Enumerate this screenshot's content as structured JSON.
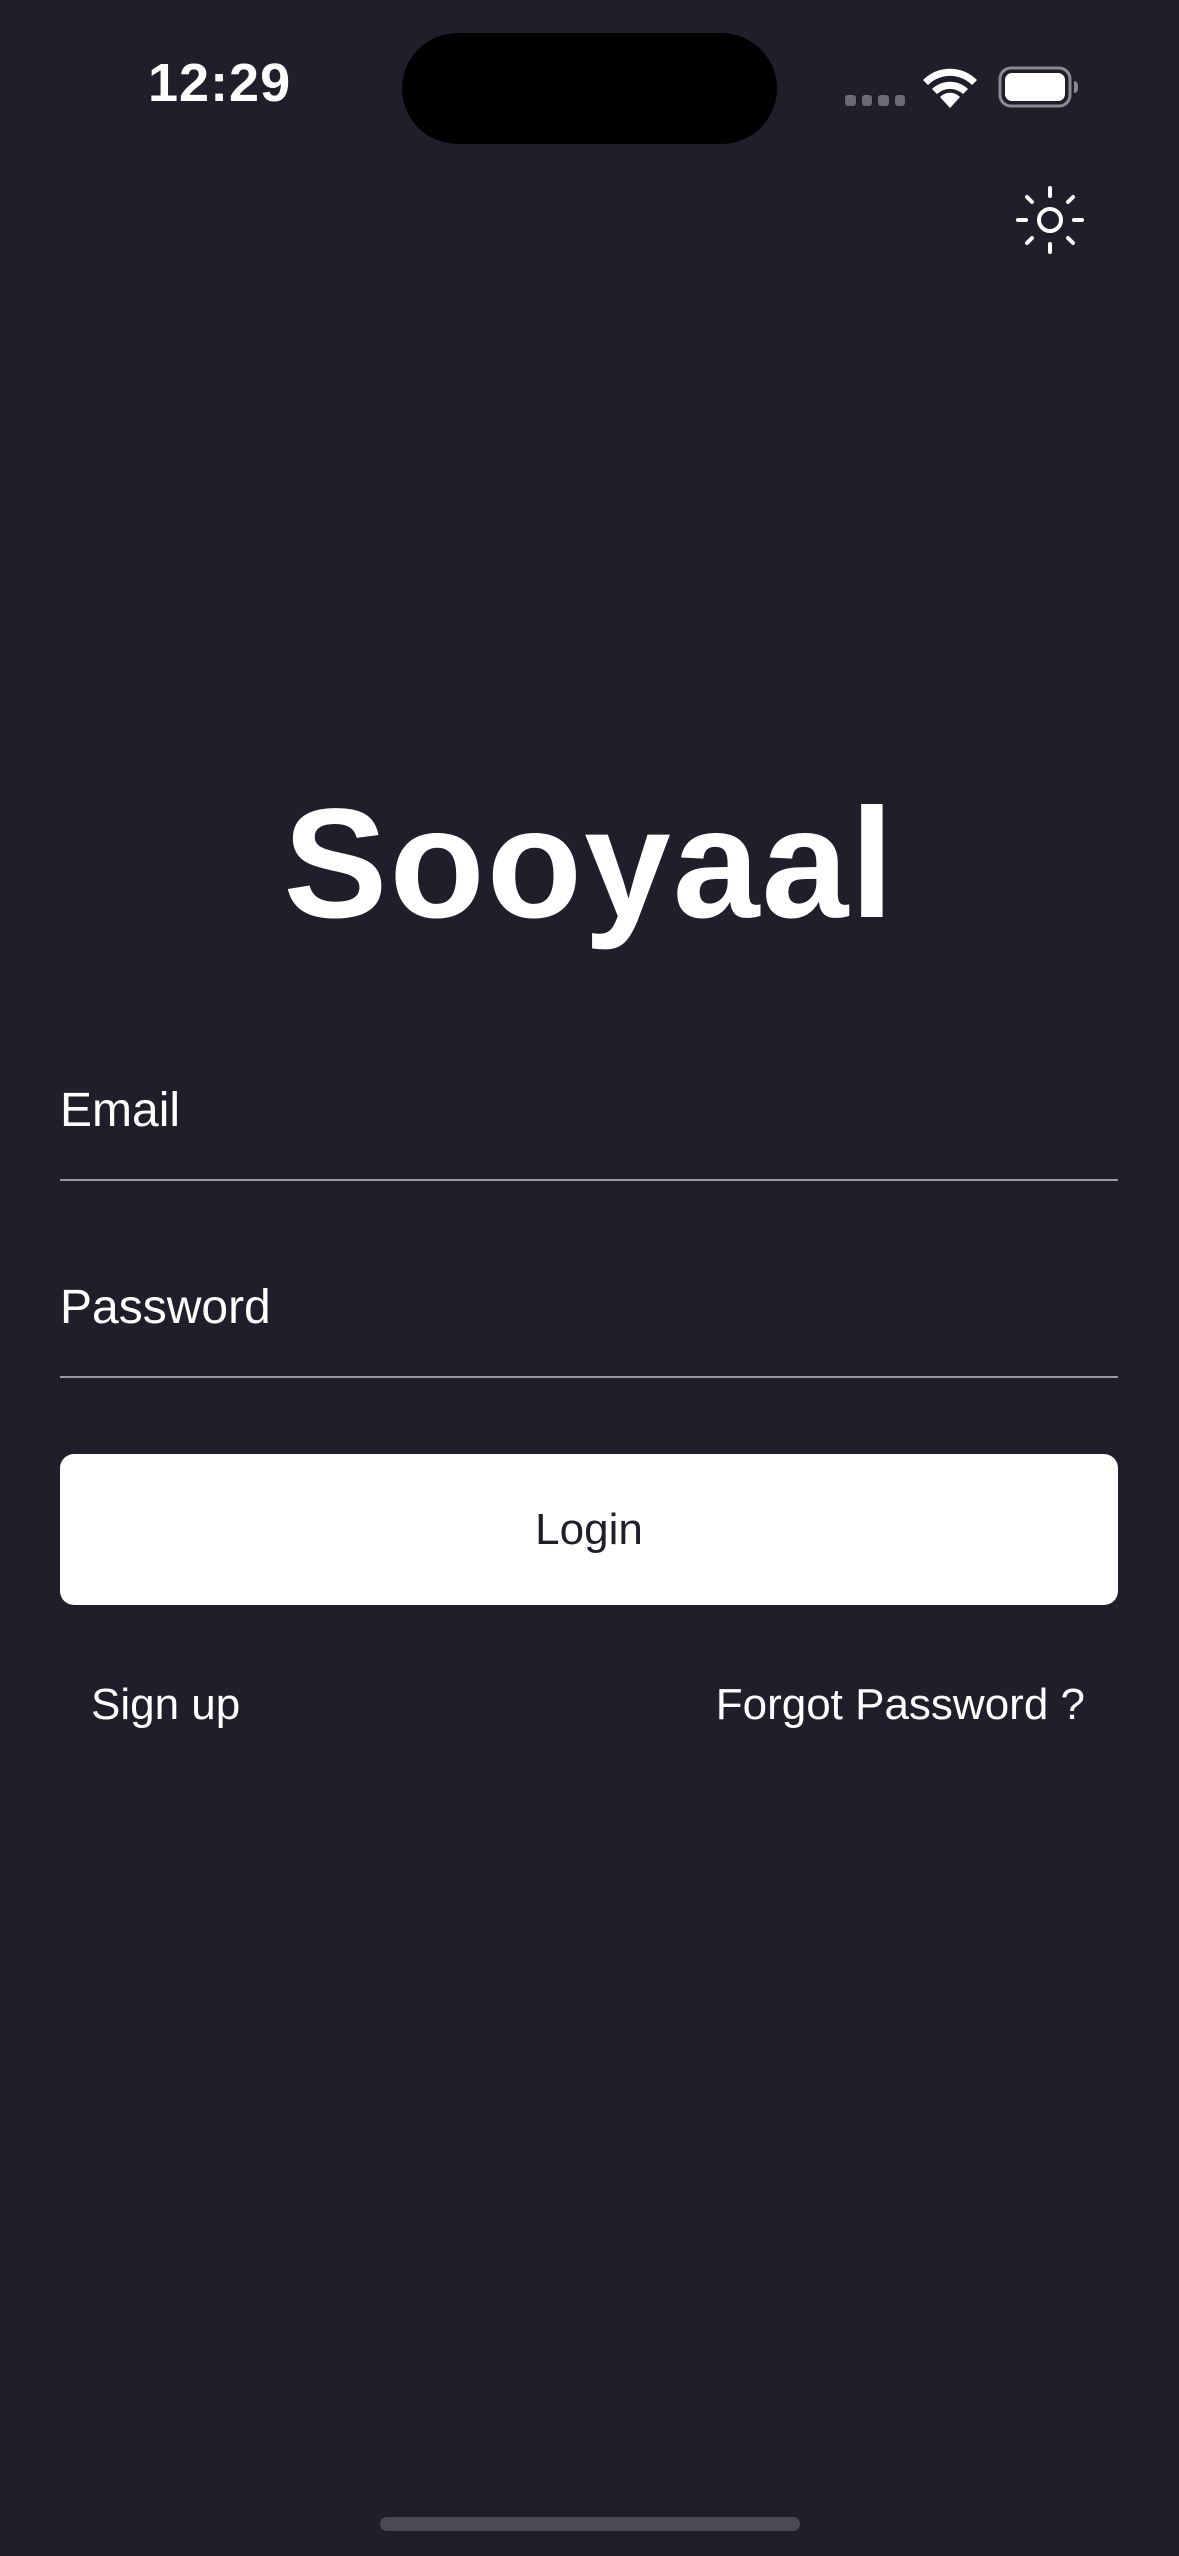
{
  "status_bar": {
    "time": "12:29",
    "icons": [
      "signal-dots-icon",
      "wifi-icon",
      "battery-icon"
    ]
  },
  "header": {
    "theme_toggle_icon": "sun-icon"
  },
  "app": {
    "title": "Sooyaal"
  },
  "form": {
    "email_placeholder": "Email",
    "password_placeholder": "Password",
    "login_label": "Login"
  },
  "links": {
    "signup": "Sign up",
    "forgot_password": "Forgot Password ?"
  },
  "colors": {
    "background": "#1f1f2b",
    "text": "#ffffff",
    "button_bg": "#ffffff",
    "button_text": "#1f1f2b",
    "underline": "#9a9aa3"
  }
}
